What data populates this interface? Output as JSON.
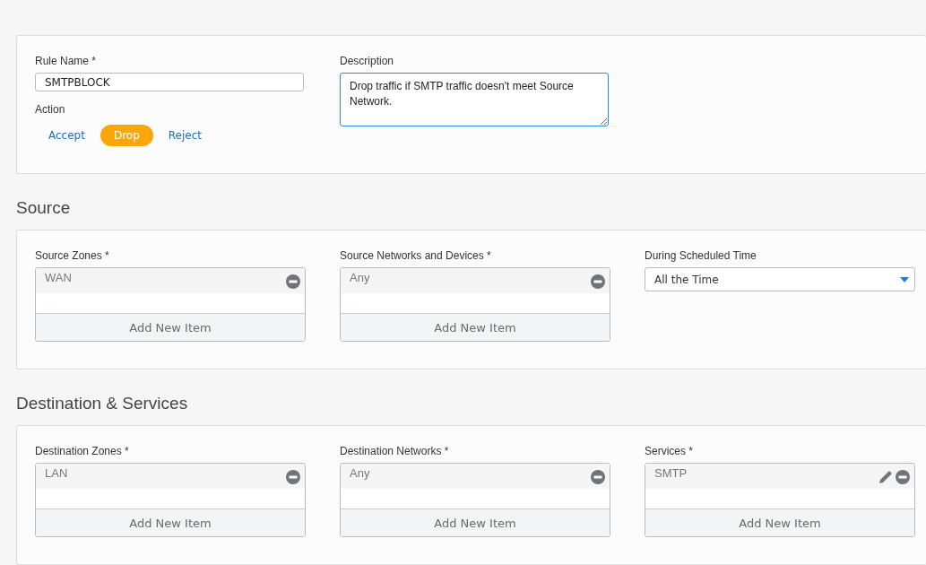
{
  "general": {
    "rule_name": {
      "label": "Rule Name *",
      "value": "SMTPBLOCK"
    },
    "action": {
      "label": "Action",
      "options": [
        {
          "label": "Accept",
          "selected": false
        },
        {
          "label": "Drop",
          "selected": true
        },
        {
          "label": "Reject",
          "selected": false
        }
      ]
    },
    "description": {
      "label": "Description",
      "value": "Drop traffic if SMTP traffic doesn't meet Source Network."
    }
  },
  "sections": [
    {
      "title": "Source",
      "fields": [
        {
          "kind": "list",
          "label": "Source Zones *",
          "items": [
            {
              "label": "WAN",
              "editable": false
            }
          ],
          "add_label": "Add New Item"
        },
        {
          "kind": "list",
          "label": "Source Networks and Devices *",
          "items": [
            {
              "label": "Any",
              "editable": false
            }
          ],
          "add_label": "Add New Item"
        },
        {
          "kind": "dropdown",
          "label": "During Scheduled Time",
          "value": "All the Time"
        }
      ]
    },
    {
      "title": "Destination & Services",
      "fields": [
        {
          "kind": "list",
          "label": "Destination Zones *",
          "items": [
            {
              "label": "LAN",
              "editable": false
            }
          ],
          "add_label": "Add New Item"
        },
        {
          "kind": "list",
          "label": "Destination Networks *",
          "items": [
            {
              "label": "Any",
              "editable": false
            }
          ],
          "add_label": "Add New Item"
        },
        {
          "kind": "list",
          "label": "Services *",
          "items": [
            {
              "label": "SMTP",
              "editable": true
            }
          ],
          "add_label": "Add New Item"
        }
      ]
    }
  ]
}
